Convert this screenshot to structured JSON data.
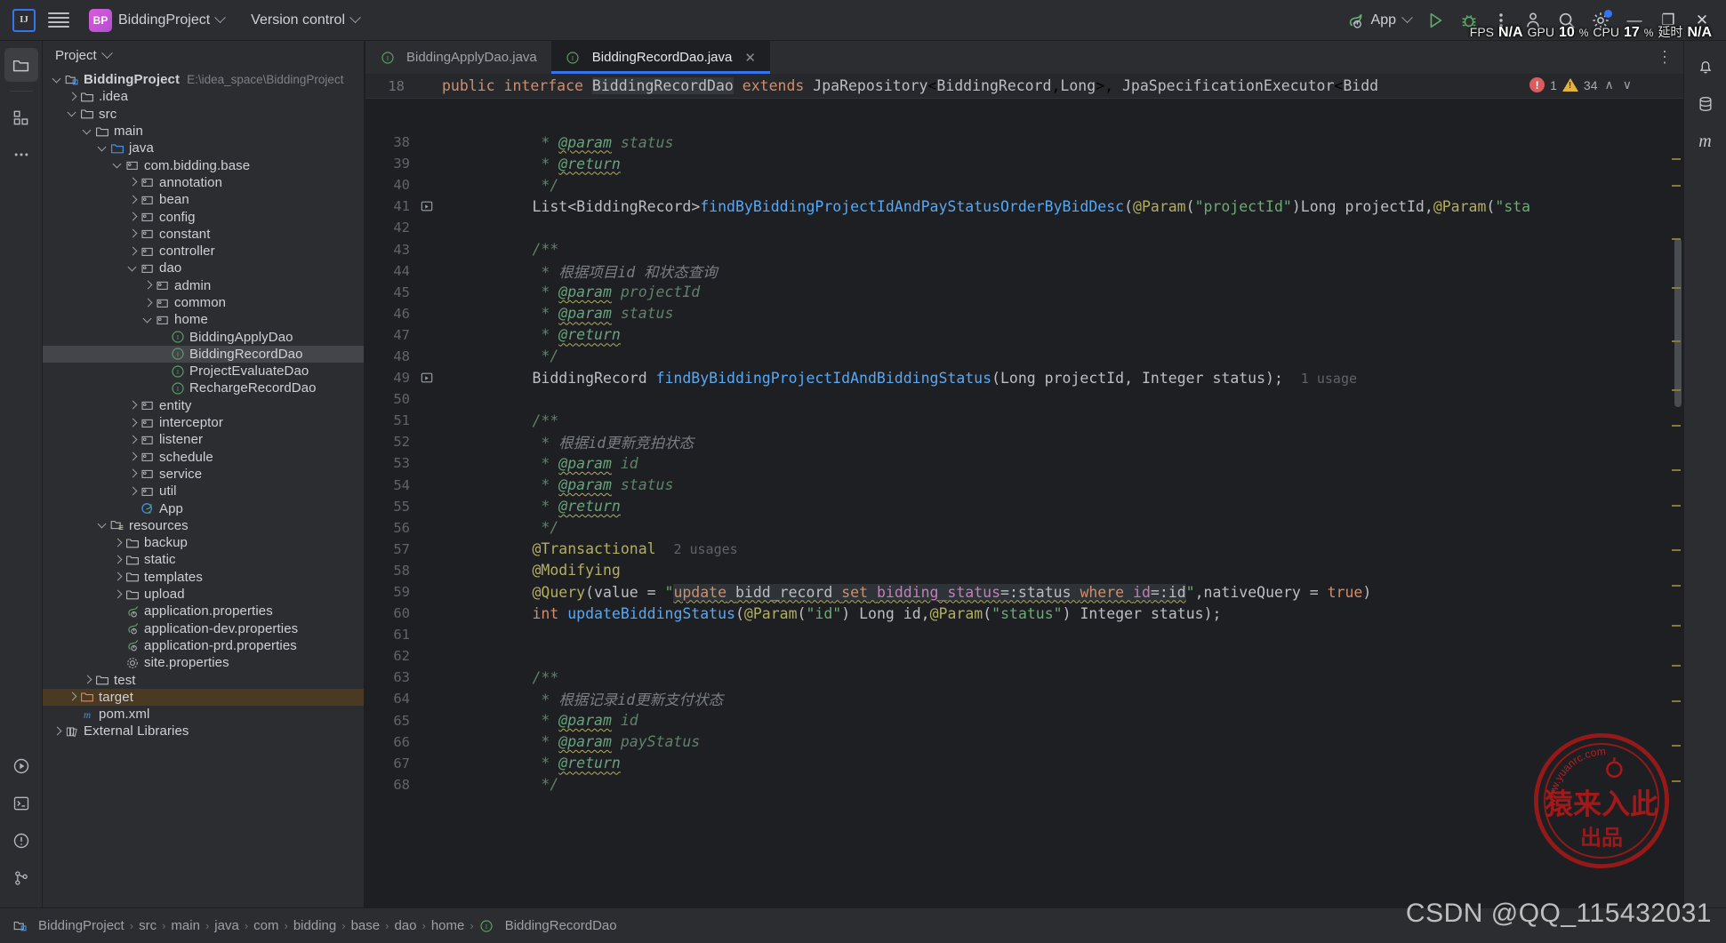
{
  "titlebar": {
    "logo_text": "IJ",
    "project_badge": "BP",
    "project_name": "BiddingProject",
    "version_control": "Version control",
    "run_config": "App",
    "icons": [
      "hamburger-menu-icon",
      "spring-boot-icon",
      "run-icon",
      "debug-icon",
      "more-actions-icon",
      "search-everywhere-icon",
      "settings-icon",
      "account-icon"
    ],
    "window": {
      "minimize": "—",
      "maximize": "❐",
      "close": "✕"
    }
  },
  "perf_overlay": {
    "fps_label": "FPS",
    "fps_value": "N/A",
    "gpu_label": "GPU",
    "gpu_value": "10",
    "gpu_unit": "%",
    "cpu_label": "CPU",
    "cpu_value": "17",
    "cpu_unit": "%",
    "latency_label": "延时",
    "latency_value": "N/A"
  },
  "left_rail": [
    {
      "name": "project-tool-window",
      "icon": "folder-icon",
      "active": true
    },
    {
      "name": "structure-tool-window",
      "icon": "structure-blocks-icon",
      "active": false
    },
    {
      "name": "more-tool-windows",
      "icon": "ellipsis-icon",
      "active": false
    }
  ],
  "left_rail_bottom": [
    {
      "name": "run-tool-window",
      "icon": "play-circle-icon"
    },
    {
      "name": "terminal-tool-window",
      "icon": "terminal-icon"
    },
    {
      "name": "problems-tool-window",
      "icon": "warning-circle-icon"
    },
    {
      "name": "version-control-tool-window",
      "icon": "git-branch-icon"
    }
  ],
  "right_rail": [
    {
      "name": "notifications",
      "icon": "bell-icon"
    },
    {
      "name": "database-tool-window",
      "icon": "database-icon"
    },
    {
      "name": "maven-tool-window",
      "icon": "maven-m-icon"
    }
  ],
  "project_panel": {
    "header": "Project",
    "header_icon": "chevron-down-icon",
    "tree": [
      {
        "depth": 0,
        "arrow": "down",
        "icon": "module-icon",
        "label": "BiddingProject",
        "bold": true,
        "path": "E:\\idea_space\\BiddingProject"
      },
      {
        "depth": 1,
        "arrow": "right",
        "icon": "folder-icon",
        "label": ".idea"
      },
      {
        "depth": 1,
        "arrow": "down",
        "icon": "folder-icon",
        "label": "src"
      },
      {
        "depth": 2,
        "arrow": "down",
        "icon": "folder-icon",
        "label": "main"
      },
      {
        "depth": 3,
        "arrow": "down",
        "icon": "source-root-icon",
        "label": "java"
      },
      {
        "depth": 4,
        "arrow": "down",
        "icon": "package-icon",
        "label": "com.bidding.base"
      },
      {
        "depth": 5,
        "arrow": "right",
        "icon": "package-icon",
        "label": "annotation"
      },
      {
        "depth": 5,
        "arrow": "right",
        "icon": "package-icon",
        "label": "bean"
      },
      {
        "depth": 5,
        "arrow": "right",
        "icon": "package-icon",
        "label": "config"
      },
      {
        "depth": 5,
        "arrow": "right",
        "icon": "package-icon",
        "label": "constant"
      },
      {
        "depth": 5,
        "arrow": "right",
        "icon": "package-icon",
        "label": "controller"
      },
      {
        "depth": 5,
        "arrow": "down",
        "icon": "package-icon",
        "label": "dao"
      },
      {
        "depth": 6,
        "arrow": "right",
        "icon": "package-icon",
        "label": "admin"
      },
      {
        "depth": 6,
        "arrow": "right",
        "icon": "package-icon",
        "label": "common"
      },
      {
        "depth": 6,
        "arrow": "down",
        "icon": "package-icon",
        "label": "home"
      },
      {
        "depth": 7,
        "arrow": "none",
        "icon": "interface-icon",
        "label": "BiddingApplyDao"
      },
      {
        "depth": 7,
        "arrow": "none",
        "icon": "interface-icon",
        "label": "BiddingRecordDao",
        "selected": true
      },
      {
        "depth": 7,
        "arrow": "none",
        "icon": "interface-icon",
        "label": "ProjectEvaluateDao"
      },
      {
        "depth": 7,
        "arrow": "none",
        "icon": "interface-icon",
        "label": "RechargeRecordDao"
      },
      {
        "depth": 5,
        "arrow": "right",
        "icon": "package-icon",
        "label": "entity"
      },
      {
        "depth": 5,
        "arrow": "right",
        "icon": "package-icon",
        "label": "interceptor"
      },
      {
        "depth": 5,
        "arrow": "right",
        "icon": "package-icon",
        "label": "listener"
      },
      {
        "depth": 5,
        "arrow": "right",
        "icon": "package-icon",
        "label": "schedule"
      },
      {
        "depth": 5,
        "arrow": "right",
        "icon": "package-icon",
        "label": "service"
      },
      {
        "depth": 5,
        "arrow": "right",
        "icon": "package-icon",
        "label": "util"
      },
      {
        "depth": 5,
        "arrow": "none",
        "icon": "spring-class-icon",
        "label": "App"
      },
      {
        "depth": 3,
        "arrow": "down",
        "icon": "resource-root-icon",
        "label": "resources"
      },
      {
        "depth": 4,
        "arrow": "right",
        "icon": "folder-icon",
        "label": "backup"
      },
      {
        "depth": 4,
        "arrow": "right",
        "icon": "folder-icon",
        "label": "static"
      },
      {
        "depth": 4,
        "arrow": "right",
        "icon": "folder-icon",
        "label": "templates"
      },
      {
        "depth": 4,
        "arrow": "right",
        "icon": "folder-icon",
        "label": "upload"
      },
      {
        "depth": 4,
        "arrow": "none",
        "icon": "spring-props-icon",
        "label": "application.properties"
      },
      {
        "depth": 4,
        "arrow": "none",
        "icon": "spring-props-icon",
        "label": "application-dev.properties"
      },
      {
        "depth": 4,
        "arrow": "none",
        "icon": "spring-props-icon",
        "label": "application-prd.properties"
      },
      {
        "depth": 4,
        "arrow": "none",
        "icon": "gear-props-icon",
        "label": "site.properties"
      },
      {
        "depth": 2,
        "arrow": "right",
        "icon": "folder-icon",
        "label": "test"
      },
      {
        "depth": 1,
        "arrow": "right",
        "icon": "excluded-folder-icon",
        "label": "target",
        "excluded": true
      },
      {
        "depth": 1,
        "arrow": "none",
        "icon": "maven-m-icon",
        "label": "pom.xml"
      },
      {
        "depth": 0,
        "arrow": "right",
        "icon": "library-icon",
        "label": "External Libraries"
      }
    ]
  },
  "editor": {
    "tabs": [
      {
        "label": "BiddingApplyDao.java",
        "icon": "interface-icon",
        "active": false,
        "closable": false
      },
      {
        "label": "BiddingRecordDao.java",
        "icon": "interface-icon",
        "active": true,
        "closable": true,
        "close_glyph": "✕"
      }
    ],
    "tab_overflow_glyph": "⋮",
    "sticky_line_number": "18",
    "inspections": {
      "error_count": "1",
      "warning_count": "34",
      "up_glyph": "∧",
      "down_glyph": "∨"
    },
    "lines": [
      {
        "n": "38",
        "gutter": ""
      },
      {
        "n": "39",
        "gutter": ""
      },
      {
        "n": "40",
        "gutter": ""
      },
      {
        "n": "41",
        "gutter": "run-method-icon"
      },
      {
        "n": "42",
        "gutter": ""
      },
      {
        "n": "43",
        "gutter": ""
      },
      {
        "n": "44",
        "gutter": ""
      },
      {
        "n": "45",
        "gutter": ""
      },
      {
        "n": "46",
        "gutter": ""
      },
      {
        "n": "47",
        "gutter": ""
      },
      {
        "n": "48",
        "gutter": ""
      },
      {
        "n": "49",
        "gutter": "run-method-icon"
      },
      {
        "n": "50",
        "gutter": ""
      },
      {
        "n": "51",
        "gutter": ""
      },
      {
        "n": "52",
        "gutter": ""
      },
      {
        "n": "53",
        "gutter": ""
      },
      {
        "n": "54",
        "gutter": ""
      },
      {
        "n": "55",
        "gutter": ""
      },
      {
        "n": "56",
        "gutter": ""
      },
      {
        "n": "57",
        "gutter": ""
      },
      {
        "n": "58",
        "gutter": ""
      },
      {
        "n": "59",
        "gutter": ""
      },
      {
        "n": "60",
        "gutter": ""
      },
      {
        "n": "61",
        "gutter": ""
      },
      {
        "n": "62",
        "gutter": ""
      },
      {
        "n": "63",
        "gutter": ""
      },
      {
        "n": "64",
        "gutter": ""
      },
      {
        "n": "65",
        "gutter": ""
      },
      {
        "n": "66",
        "gutter": ""
      },
      {
        "n": "67",
        "gutter": ""
      },
      {
        "n": "68",
        "gutter": ""
      }
    ],
    "code_text": {
      "l18": "public interface BiddingRecordDao extends JpaRepository<BiddingRecord,Long>, JpaSpecificationExecutor<Bidd",
      "l38": "* @param status",
      "l39": "* @return",
      "l40": "*/",
      "l41": "List<BiddingRecord>findByBiddingProjectIdAndPayStatusOrderByBidDesc(@Param(\"projectId\")Long projectId,@Param(\"sta",
      "l43": "/**",
      "l44": "* 根据项目id 和状态查询",
      "l45": "* @param projectId",
      "l46": "* @param status",
      "l47": "* @return",
      "l48": "*/",
      "l49": "BiddingRecord findByBiddingProjectIdAndBiddingStatus(Long projectId, Integer status);",
      "l49_usage": "1 usage",
      "l51": "/**",
      "l52": "* 根据id更新竞拍状态",
      "l53": "* @param id",
      "l54": "* @param status",
      "l55": "* @return",
      "l56": "*/",
      "l57": "@Transactional",
      "l57_usage": "2 usages",
      "l58": "@Modifying",
      "l59_pre": "@Query(value = ",
      "l59_sql": "update bidd_record set bidding_status=:status where id=:id",
      "l59_post": ",nativeQuery = true)",
      "l60": "int updateBiddingStatus(@Param(\"id\") Long id,@Param(\"status\") Integer status);",
      "l63": "/**",
      "l64": "* 根据记录id更新支付状态",
      "l65": "* @param id",
      "l66": "* @param payStatus",
      "l67": "* @return",
      "l68": "*/"
    }
  },
  "statusbar": {
    "breadcrumbs": [
      {
        "label": "BiddingProject",
        "icon": "module-small-icon"
      },
      {
        "label": "src"
      },
      {
        "label": "main"
      },
      {
        "label": "java"
      },
      {
        "label": "com"
      },
      {
        "label": "bidding"
      },
      {
        "label": "base"
      },
      {
        "label": "dao"
      },
      {
        "label": "home"
      },
      {
        "label": "BiddingRecordDao",
        "icon": "interface-icon"
      }
    ],
    "separator": "›"
  },
  "watermark": {
    "stamp_url_text": "www.yuanrc.com",
    "stamp_line1": "猿来入此",
    "stamp_line2": "出品",
    "csdn_text": "CSDN @QQ_115432031"
  },
  "colors": {
    "accent_blue": "#3574f0",
    "panel_bg": "#2b2d30",
    "editor_bg": "#1e1f22",
    "keyword": "#cf8e6d",
    "method": "#56a8f5",
    "string": "#6aab73",
    "annotation": "#b3ae60",
    "comment": "#5f826b",
    "error_red": "#db5c5c",
    "warning_yellow": "#e3b341",
    "excluded_brown": "#4b3a22",
    "stamp_red": "#c01818"
  }
}
